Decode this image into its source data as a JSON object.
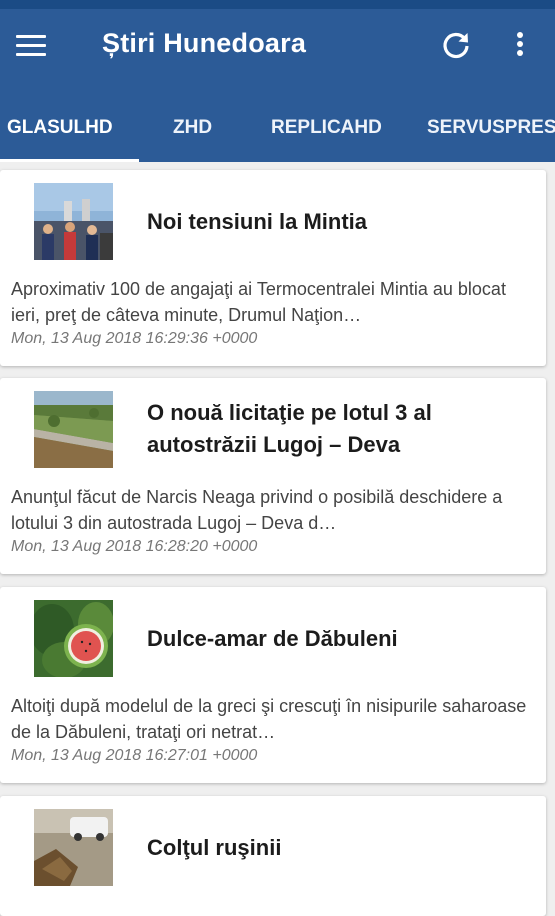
{
  "app": {
    "title": "Știri Hunedoara",
    "menu_icon": "hamburger-menu-icon",
    "refresh_icon": "refresh-icon",
    "more_icon": "more-vertical-icon",
    "primary_color": "#2c5b97",
    "status_bar_color": "#1b4b85"
  },
  "tabs": [
    {
      "label": "GLASULHD",
      "selected": true
    },
    {
      "label": "ZHD",
      "selected": false
    },
    {
      "label": "REPLICAHD",
      "selected": false
    },
    {
      "label": "SERVUSPRESS",
      "selected": false
    }
  ],
  "articles": [
    {
      "title": "Noi tensiuni la Mintia",
      "description": "Aproximativ 100 de angajaţi ai Termocentralei Mintia au blocat ieri, preţ de câteva minute, Drumul Naţion…",
      "date": "Mon, 13 Aug 2018 16:29:36 +0000"
    },
    {
      "title": "O nouă licitaţie pe lotul 3 al autostrăzii Lugoj – Deva",
      "description": "Anunţul făcut de Narcis Neaga privind o posibilă deschidere a lotului 3 din autostrada Lugoj – Deva d…",
      "date": "Mon, 13 Aug 2018 16:28:20 +0000"
    },
    {
      "title": "Dulce-amar de Dăbuleni",
      "description": "Altoiţi după modelul de la greci şi crescuţi în nisipurile saharoase de la Dăbuleni, trataţi ori netrat…",
      "date": "Mon, 13 Aug 2018 16:27:01 +0000"
    },
    {
      "title": "Colţul ruşinii",
      "description": "",
      "date": ""
    }
  ]
}
